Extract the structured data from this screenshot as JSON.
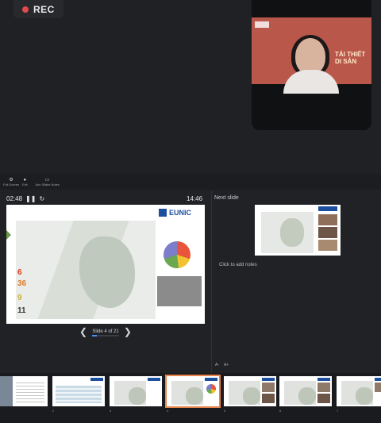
{
  "recording": {
    "label": "REC",
    "dot_color": "#e5484d"
  },
  "video": {
    "background_slide_title": "TÁI THIẾT\nDI SẢN",
    "slide_color": "#b9574a"
  },
  "toolbar": {
    "items": [
      {
        "label": "Full Screen",
        "icon": "gear-icon"
      },
      {
        "label": "Exit",
        "icon": "exit-icon"
      },
      {
        "label": "Join Slides Notes",
        "icon": "slides-icon"
      }
    ]
  },
  "presenter": {
    "timer": "02:48",
    "clock": "14:46",
    "next_slide_label": "Next slide",
    "notes_placeholder": "Click to add notes",
    "slide_counter": "Slide 4 of 21",
    "progress_fraction": 0.19,
    "font_decrease": "A-",
    "font_increase": "A+"
  },
  "current_slide": {
    "logo_text": "EUNIC",
    "accent_color": "#1d4fa0",
    "legend_numbers": [
      "6",
      "36",
      "9",
      "11"
    ],
    "legend_colors": [
      "#d9391a",
      "#e07b28",
      "#c9b13b",
      "#333333"
    ]
  },
  "filmstrip": {
    "thumbnails": [
      {
        "number": "1",
        "kind": "photo-text"
      },
      {
        "number": "2",
        "kind": "table"
      },
      {
        "number": "3",
        "kind": "map"
      },
      {
        "number": "4",
        "kind": "map-pie",
        "active": true
      },
      {
        "number": "5",
        "kind": "map-photos"
      },
      {
        "number": "6",
        "kind": "map-photos"
      },
      {
        "number": "7",
        "kind": "map-photos"
      }
    ],
    "active_color": "#e5834a"
  }
}
